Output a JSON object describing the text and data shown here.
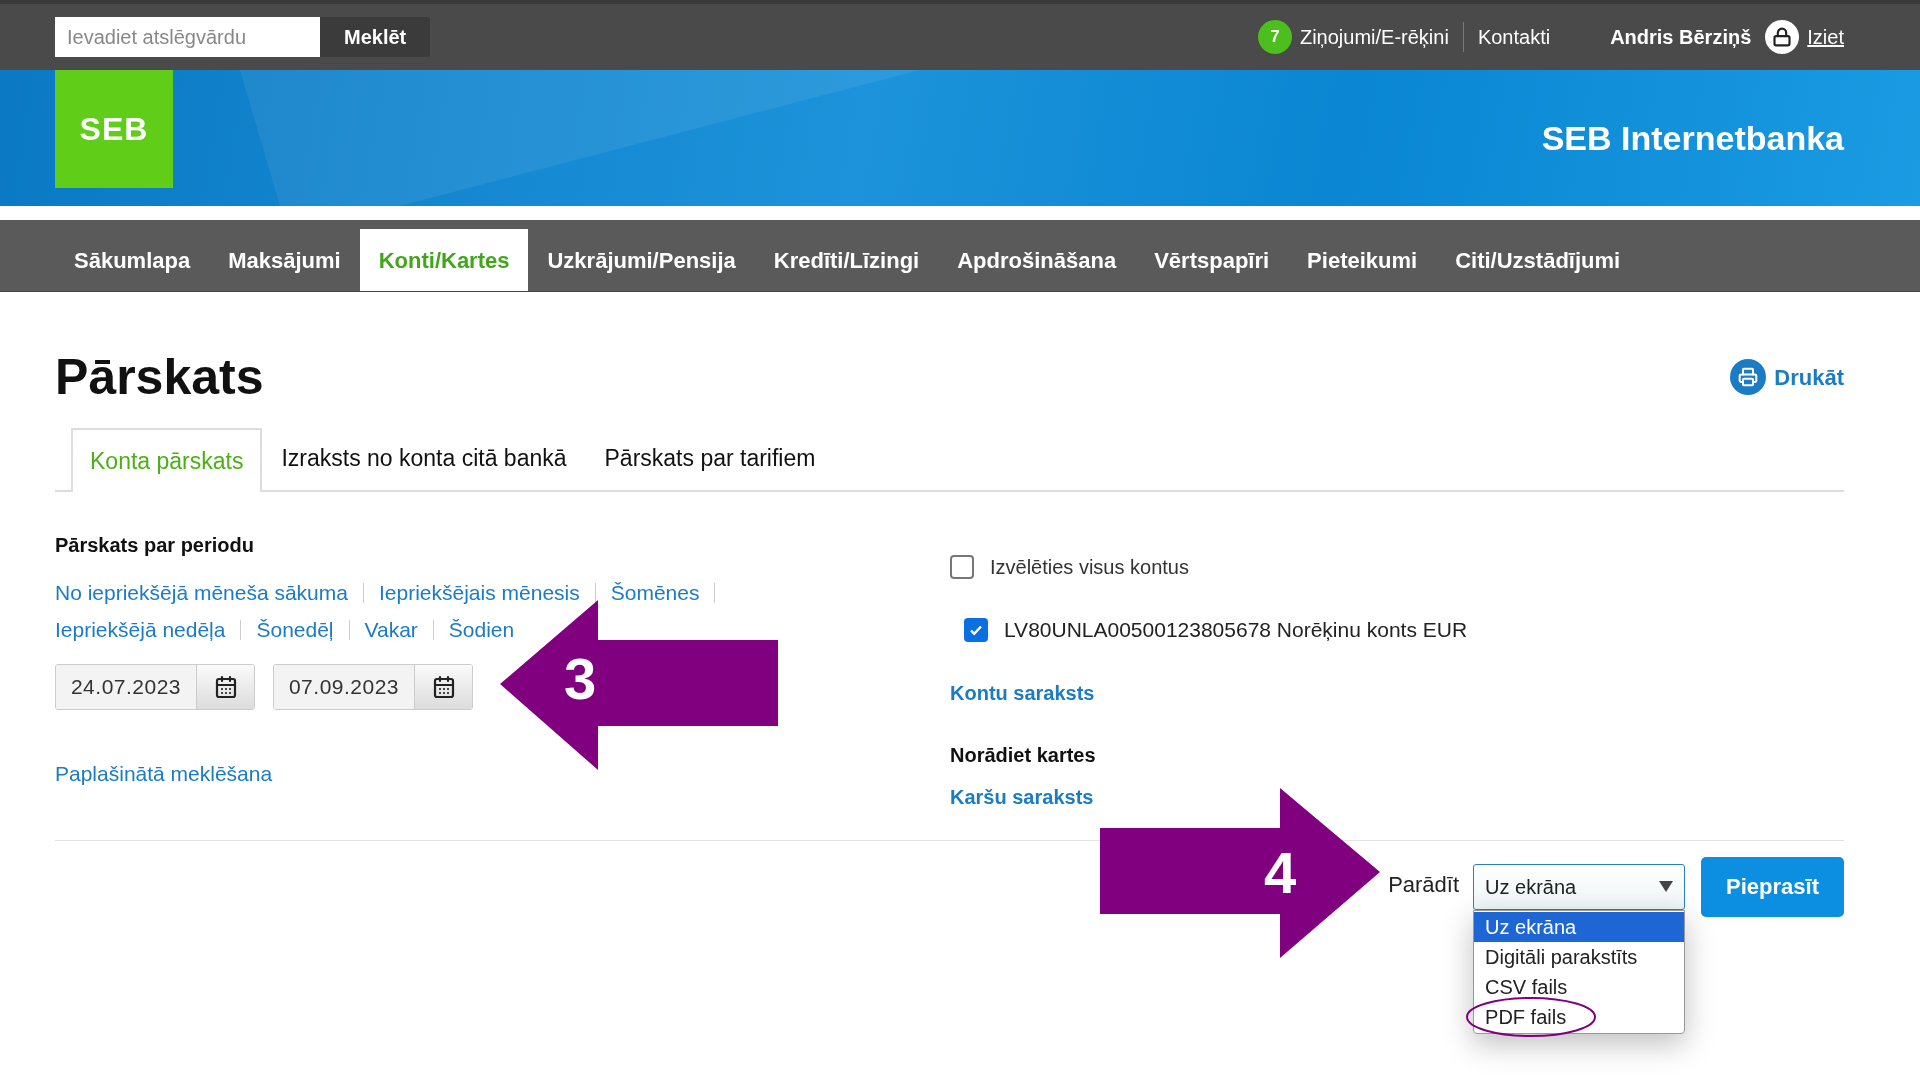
{
  "top_bar": {
    "search": {
      "placeholder": "Ievadiet atslēgvārdu"
    },
    "search_button": "Meklēt",
    "messages_badge": "7",
    "messages": "Ziņojumi/E-rēķini",
    "contacts": "Kontakti",
    "user": "Andris Bērziņš",
    "logout": "Iziet"
  },
  "banner": {
    "logo": "SEB",
    "title": "SEB Internetbanka"
  },
  "nav": [
    {
      "label": "Sākumlapa",
      "selected": false
    },
    {
      "label": "Maksājumi",
      "selected": false
    },
    {
      "label": "Konti/Kartes",
      "selected": true
    },
    {
      "label": "Uzkrājumi/Pensija",
      "selected": false
    },
    {
      "label": "Kredīti/Līzingi",
      "selected": false
    },
    {
      "label": "Apdrošināšana",
      "selected": false
    },
    {
      "label": "Vērtspapīri",
      "selected": false
    },
    {
      "label": "Pieteikumi",
      "selected": false
    },
    {
      "label": "Citi/Uzstādījumi",
      "selected": false
    }
  ],
  "page": {
    "title": "Pārskats",
    "print": "Drukāt"
  },
  "tabs": [
    {
      "label": "Konta pārskats",
      "selected": true
    },
    {
      "label": "Izraksts no konta citā bankā",
      "selected": false
    },
    {
      "label": "Pārskats par tarifiem",
      "selected": false
    }
  ],
  "period": {
    "heading": "Pārskats par periodu",
    "link_rows": [
      {
        "links": [
          "No iepriekšējā mēneša sākuma",
          "Iepriekšējais mēnesis",
          "Šomēnes"
        ]
      },
      {
        "links": [
          "Iepriekšējā nedēļa",
          "Šonedēļ",
          "Vakar",
          "Šodien"
        ]
      }
    ],
    "date_from": "24.07.2023",
    "date_to": "07.09.2023",
    "advanced_search": "Paplašinātā meklēšana"
  },
  "accounts": {
    "select_all": {
      "label": "Izvēlēties visus kontus",
      "checked": false
    },
    "items": [
      {
        "label": "LV80UNLA00500123805678 Norēķinu konts EUR",
        "checked": true
      }
    ],
    "list_link": "Kontu saraksts"
  },
  "cards": {
    "heading": "Norādiet kartes",
    "list_link": "Karšu saraksts"
  },
  "output": {
    "label": "Parādīt",
    "value": "Uz ekrāna",
    "options": [
      {
        "label": "Uz ekrāna",
        "selected": true,
        "circled": false
      },
      {
        "label": "Digitāli parakstīts",
        "selected": false,
        "circled": false
      },
      {
        "label": "CSV fails",
        "selected": false,
        "circled": false
      },
      {
        "label": "PDF fails",
        "selected": false,
        "circled": true
      }
    ],
    "submit": "Pieprasīt"
  },
  "annotations": [
    {
      "kind": "arrow_left",
      "label": "3"
    },
    {
      "kind": "arrow_right",
      "label": "4"
    }
  ]
}
